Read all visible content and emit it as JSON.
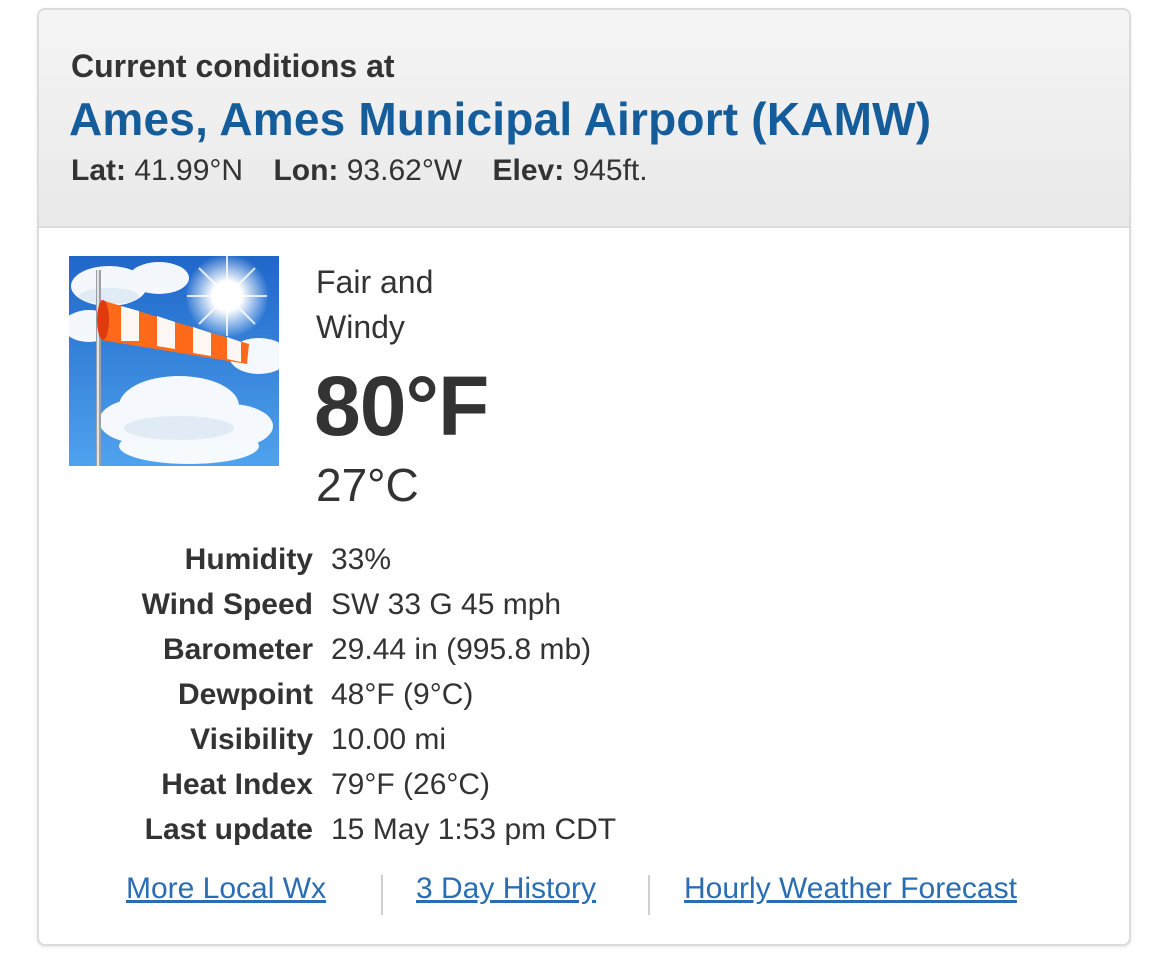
{
  "header": {
    "label": "Current conditions at",
    "station": "Ames, Ames Municipal Airport (KAMW)",
    "lat_label": "Lat:",
    "lat_value": "41.99°N",
    "lon_label": "Lon:",
    "lon_value": "93.62°W",
    "elev_label": "Elev:",
    "elev_value": "945ft."
  },
  "current": {
    "icon": "windsock-sun-clouds-icon",
    "condition_line1": "Fair and",
    "condition_line2": "Windy",
    "temp_f": "80°F",
    "temp_c": "27°C"
  },
  "details": [
    {
      "label": "Humidity",
      "value": "33%"
    },
    {
      "label": "Wind Speed",
      "value": "SW 33 G 45 mph"
    },
    {
      "label": "Barometer",
      "value": "29.44 in (995.8 mb)"
    },
    {
      "label": "Dewpoint",
      "value": "48°F (9°C)"
    },
    {
      "label": "Visibility",
      "value": "10.00 mi"
    },
    {
      "label": "Heat Index",
      "value": "79°F (26°C)"
    },
    {
      "label": "Last update",
      "value": "15 May 1:53 pm CDT"
    }
  ],
  "links": {
    "more_local": "More Local Wx",
    "history": "3 Day History",
    "hourly": "Hourly Weather Forecast"
  },
  "colors": {
    "station_title": "#155d9a",
    "link": "#2a6db3",
    "header_bg": "#eeeeee"
  }
}
